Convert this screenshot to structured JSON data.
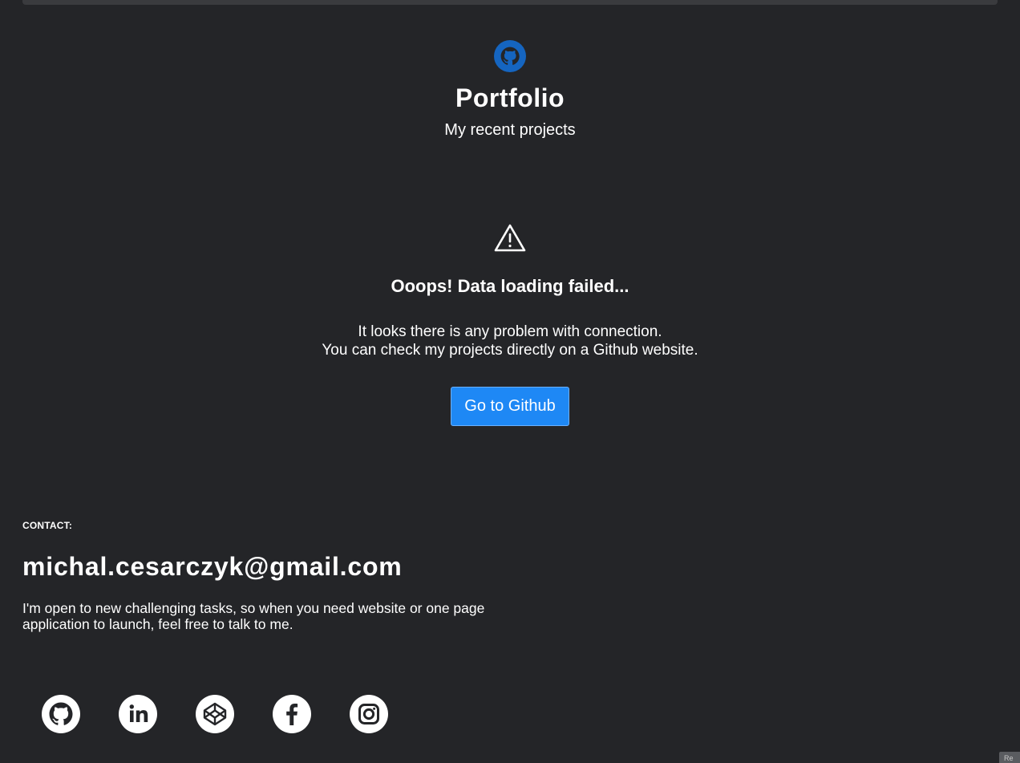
{
  "header": {
    "logo_icon": "github-icon",
    "title": "Portfolio",
    "subtitle": "My recent projects"
  },
  "error": {
    "icon": "warning-icon",
    "title": "Ooops! Data loading failed...",
    "line1": "It looks there is any problem with connection.",
    "line2": "You can check my projects directly on a Github website.",
    "button_label": "Go to Github"
  },
  "contact": {
    "label": "CONTACT:",
    "email": "michal.cesarczyk@gmail.com",
    "text": "I'm open to new challenging tasks, so when you need website or one page application to launch, feel free to talk to me."
  },
  "socials": [
    {
      "icon": "github-icon"
    },
    {
      "icon": "linkedin-icon"
    },
    {
      "icon": "codepen-icon"
    },
    {
      "icon": "facebook-icon"
    },
    {
      "icon": "instagram-icon"
    }
  ],
  "colors": {
    "background": "#242528",
    "accent": "#1e88f5",
    "logo": "#1565c0",
    "text": "#ffffff"
  },
  "corner_tab_text": "Re"
}
